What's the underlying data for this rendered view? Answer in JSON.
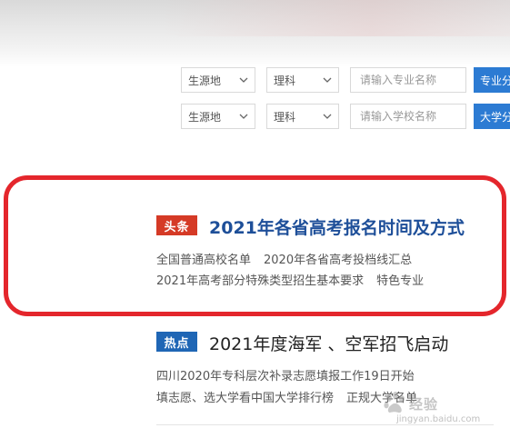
{
  "search": {
    "row1": {
      "origin_select": "生源地",
      "subject_select": "理科",
      "input_placeholder": "请输入专业名称",
      "button_label": "专业分"
    },
    "row2": {
      "origin_select": "生源地",
      "subject_select": "理科",
      "input_placeholder": "请输入学校名称",
      "button_label": "大学分"
    }
  },
  "headline_section": {
    "tag": "头条",
    "title": "2021年各省高考报名时间及方式",
    "links_line1": [
      "全国普通高校名单",
      "2020年各省高考投档线汇总"
    ],
    "links_line2": [
      "2021年高考部分特殊类型招生基本要求",
      "特色专业"
    ]
  },
  "hot_section": {
    "tag": "热点",
    "title": "2021年度海军 、空军招飞启动",
    "links_line1": [
      "四川2020年专科层次补录志愿填报工作19日开始"
    ],
    "links_line2": [
      "填志愿、选大学看中国大学排行榜",
      "正规大学名单"
    ]
  },
  "watermark": {
    "brand": "经验",
    "url": "jingyan.baidu.com",
    "icon": "baidu-paw-icon"
  },
  "colors": {
    "highlight_border": "#e4262c",
    "tag_red": "#d53a26",
    "tag_blue": "#1f66b5",
    "button_blue": "#2c7bd3",
    "headline_blue": "#1e4f99"
  }
}
